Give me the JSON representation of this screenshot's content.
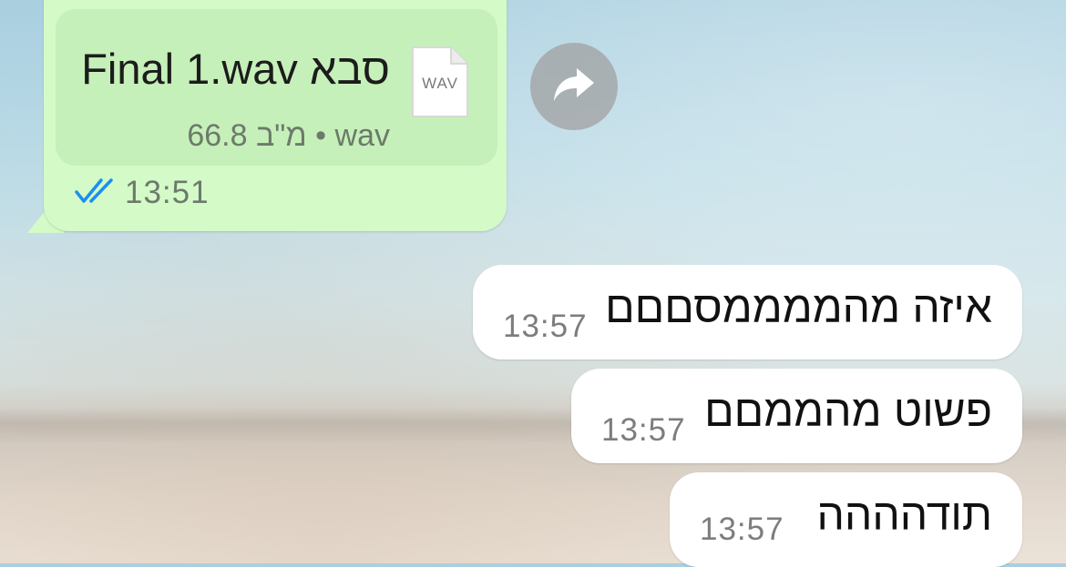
{
  "outgoing_file_message": {
    "file_name": "Final 1.wav סבא",
    "file_size_and_type": "66.8 מ\"ב • wav",
    "file_icon_label": "WAV",
    "time": "13:51",
    "read_status": "double-blue-check-icon",
    "bubble_color": "#d4fac8",
    "card_color": "#c6f0b9",
    "check_color": "#1b8ff1"
  },
  "forward_button": {
    "icon": "forward-arrow-icon"
  },
  "incoming_messages": [
    {
      "text": "איזה מהממממסםםם",
      "time": "13:57"
    },
    {
      "text": "פשוט מהממםם",
      "time": "13:57"
    },
    {
      "text": "תודהההה",
      "time": "13:57"
    }
  ]
}
